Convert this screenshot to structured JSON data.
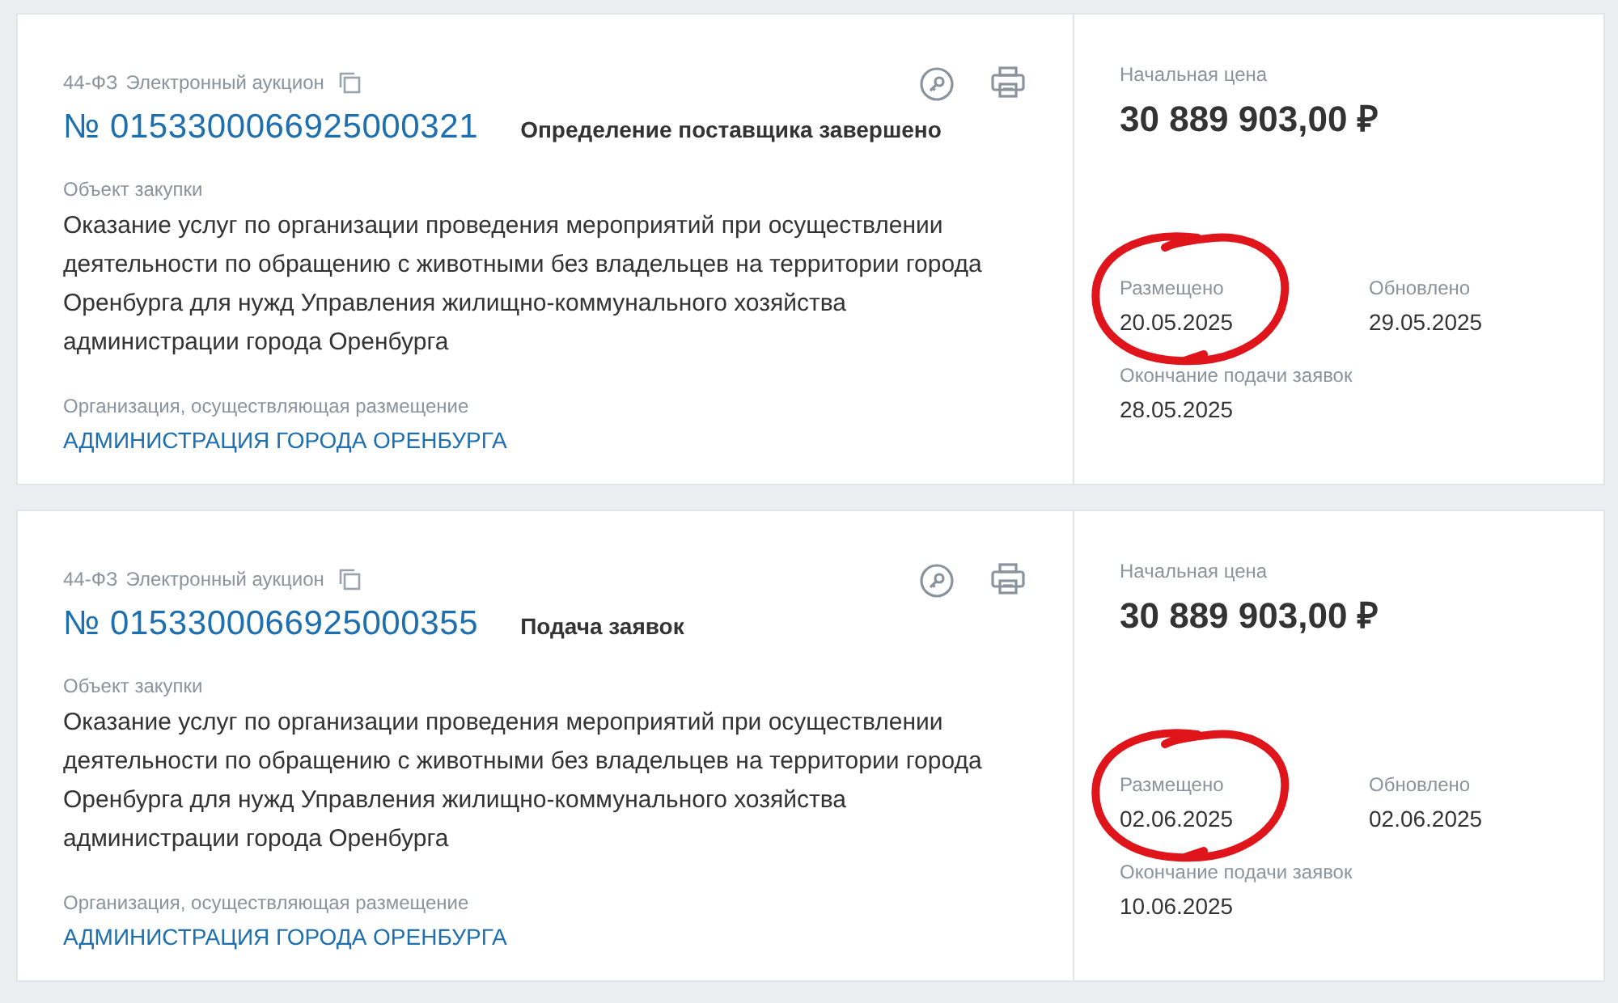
{
  "cards": [
    {
      "law": "44-ФЗ",
      "method": "Электронный аукцион",
      "number": "№ 0153300066925000321",
      "status": "Определение поставщика завершено",
      "object_label": "Объект закупки",
      "object": "Оказание услуг по организации проведения мероприятий при осуществлении деятельности по обращению с животными без владельцев на территории города Оренбурга для нужд Управления жилищно-коммунального хозяйства администрации города Оренбурга",
      "org_label": "Организация, осуществляющая размещение",
      "org": "АДМИНИСТРАЦИЯ ГОРОДА ОРЕНБУРГА",
      "price_label": "Начальная цена",
      "price": "30 889 903,00 ₽",
      "placed_label": "Размещено",
      "placed": "20.05.2025",
      "placed_circled": true,
      "updated_label": "Обновлено",
      "updated": "29.05.2025",
      "deadline_label": "Окончание подачи заявок",
      "deadline": "28.05.2025"
    },
    {
      "law": "44-ФЗ",
      "method": "Электронный аукцион",
      "number": "№ 0153300066925000355",
      "status": "Подача заявок",
      "object_label": "Объект закупки",
      "object": "Оказание услуг по организации проведения мероприятий при осуществлении деятельности по обращению с животными без владельцев на территории города Оренбурга для нужд Управления жилищно-коммунального хозяйства администрации города Оренбурга",
      "org_label": "Организация, осуществляющая размещение",
      "org": "АДМИНИСТРАЦИЯ ГОРОДА ОРЕНБУРГА",
      "price_label": "Начальная цена",
      "price": "30 889 903,00 ₽",
      "placed_label": "Размещено",
      "placed": "02.06.2025",
      "placed_circled": true,
      "updated_label": "Обновлено",
      "updated": "02.06.2025",
      "deadline_label": "Окончание подачи заявок",
      "deadline": "10.06.2025"
    }
  ]
}
